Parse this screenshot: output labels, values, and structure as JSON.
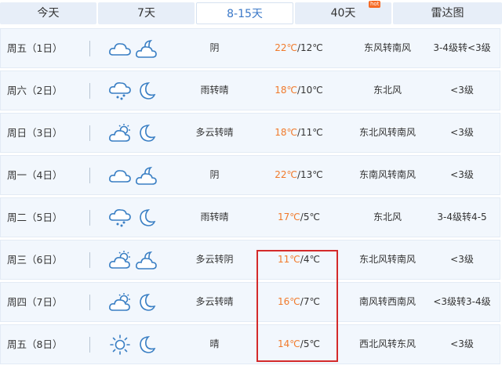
{
  "tabs": [
    {
      "label": "今天",
      "active": false
    },
    {
      "label": "7天",
      "active": false
    },
    {
      "label": "8-15天",
      "active": true
    },
    {
      "label": "40天",
      "active": false,
      "badge": "hot"
    },
    {
      "label": "雷达图",
      "active": false
    }
  ],
  "colors": {
    "high_temp": "#f17a2b",
    "highlight_box": "#d42a2a",
    "accent": "#3a78c8"
  },
  "rows": [
    {
      "date": "周五（1日）",
      "day_icon": "cloudy-icon",
      "night_icon": "moon-cloud-icon",
      "condition": "阴",
      "high": "22℃",
      "low": "12℃",
      "wind": "东风转南风",
      "level": "3-4级转<3级"
    },
    {
      "date": "周六（2日）",
      "day_icon": "rain-icon",
      "night_icon": "moon-icon",
      "condition": "雨转晴",
      "high": "18℃",
      "low": "10℃",
      "wind": "东北风",
      "level": "<3级"
    },
    {
      "date": "周日（3日）",
      "day_icon": "partly-cloudy-icon",
      "night_icon": "moon-icon",
      "condition": "多云转晴",
      "high": "18℃",
      "low": "11℃",
      "wind": "东北风转南风",
      "level": "<3级"
    },
    {
      "date": "周一（4日）",
      "day_icon": "cloudy-icon",
      "night_icon": "moon-cloud-icon",
      "condition": "阴",
      "high": "22℃",
      "low": "13℃",
      "wind": "东南风转南风",
      "level": "<3级"
    },
    {
      "date": "周二（5日）",
      "day_icon": "rain-icon",
      "night_icon": "moon-icon",
      "condition": "雨转晴",
      "high": "17℃",
      "low": "5℃",
      "wind": "东北风",
      "level": "3-4级转4-5"
    },
    {
      "date": "周三（6日）",
      "day_icon": "partly-cloudy-icon",
      "night_icon": "moon-cloud-icon",
      "condition": "多云转阴",
      "high": "11℃",
      "low": "4℃",
      "wind": "东北风转南风",
      "level": "<3级"
    },
    {
      "date": "周四（7日）",
      "day_icon": "partly-cloudy-icon",
      "night_icon": "moon-icon",
      "condition": "多云转晴",
      "high": "16℃",
      "low": "7℃",
      "wind": "南风转西南风",
      "level": "<3级转3-4级"
    },
    {
      "date": "周五（8日）",
      "day_icon": "sun-icon",
      "night_icon": "moon-icon",
      "condition": "晴",
      "high": "14℃",
      "low": "5℃",
      "wind": "西北风转东风",
      "level": "<3级"
    }
  ]
}
